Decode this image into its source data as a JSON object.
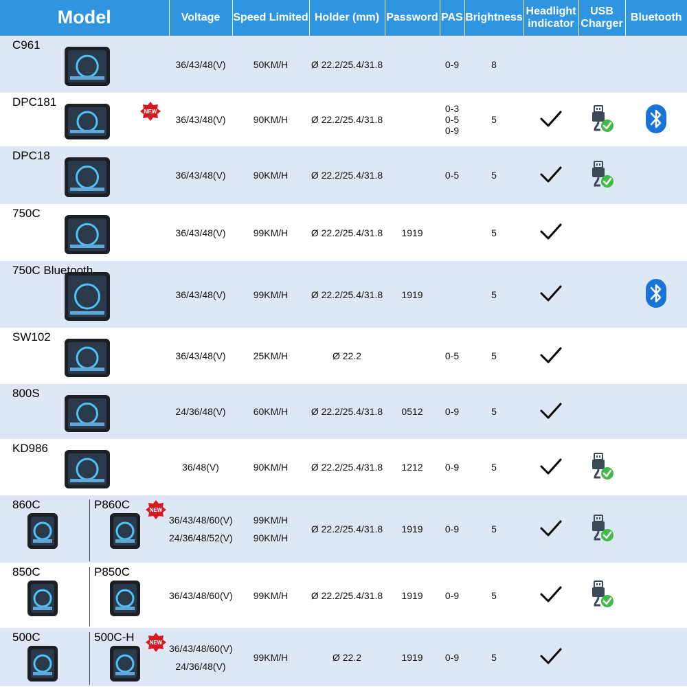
{
  "headers": {
    "model": "Model",
    "voltage": "Voltage",
    "speed": "Speed Limited",
    "holder": "Holder (mm)",
    "password": "Password",
    "pas": "PAS",
    "brightness": "Brightness",
    "headlight_1": "Headlight",
    "headlight_2": "indicator",
    "usb_1": "USB",
    "usb_2": "Charger",
    "bluetooth": "Bluetooth"
  },
  "badges": {
    "new": "NEW"
  },
  "rows": [
    {
      "model": "C961",
      "voltage": "36/43/48(V)",
      "speed": "50KM/H",
      "holder": "Ø 22.2/25.4/31.8",
      "password": "",
      "pas": "0-9",
      "brightness": "8",
      "headlight": false,
      "usb": false,
      "bluetooth": false
    },
    {
      "model": "DPC181",
      "new_badge": true,
      "voltage": "36/43/48(V)",
      "speed": "90KM/H",
      "holder": "Ø 22.2/25.4/31.8",
      "password": "",
      "pas": [
        "0-3",
        "0-5",
        "0-9"
      ],
      "brightness": "5",
      "headlight": true,
      "usb": true,
      "bluetooth": true
    },
    {
      "model": "DPC18",
      "voltage": "36/43/48(V)",
      "speed": "90KM/H",
      "holder": "Ø 22.2/25.4/31.8",
      "password": "",
      "pas": "0-5",
      "brightness": "5",
      "headlight": true,
      "usb": true,
      "bluetooth": false
    },
    {
      "model": "750C",
      "voltage": "36/43/48(V)",
      "speed": "99KM/H",
      "holder": "Ø 22.2/25.4/31.8",
      "password": "1919",
      "pas": "",
      "brightness": "5",
      "headlight": true,
      "usb": false,
      "bluetooth": false
    },
    {
      "model": "750C Bluetooth",
      "voltage": "36/43/48(V)",
      "speed": "99KM/H",
      "holder": "Ø 22.2/25.4/31.8",
      "password": "1919",
      "pas": "",
      "brightness": "5",
      "headlight": true,
      "usb": false,
      "bluetooth": true
    },
    {
      "model": "SW102",
      "voltage": "36/43/48(V)",
      "speed": "25KM/H",
      "holder": "Ø 22.2",
      "password": "",
      "pas": "0-5",
      "brightness": "5",
      "headlight": true,
      "usb": false,
      "bluetooth": false
    },
    {
      "model": "800S",
      "voltage": "24/36/48(V)",
      "speed": "60KM/H",
      "holder": "Ø 22.2/25.4/31.8",
      "password": "0512",
      "pas": "0-9",
      "brightness": "5",
      "headlight": true,
      "usb": false,
      "bluetooth": false
    },
    {
      "model": "KD986",
      "voltage": "36/48(V)",
      "speed": "90KM/H",
      "holder": "Ø 22.2/25.4/31.8",
      "password": "1212",
      "pas": "0-9",
      "brightness": "5",
      "headlight": true,
      "usb": true,
      "bluetooth": false
    },
    {
      "model": "860C",
      "model_b": "P860C",
      "new_badge": true,
      "voltage": [
        "36/43/48/60(V)",
        "24/36/48/52(V)"
      ],
      "speed": [
        "99KM/H",
        "90KM/H"
      ],
      "holder": "Ø 22.2/25.4/31.8",
      "password": "1919",
      "pas": "0-9",
      "brightness": "5",
      "headlight": true,
      "usb": true,
      "bluetooth": false
    },
    {
      "model": "850C",
      "model_b": "P850C",
      "voltage": "36/43/48/60(V)",
      "speed": "99KM/H",
      "holder": "Ø 22.2/25.4/31.8",
      "password": "1919",
      "pas": "0-9",
      "brightness": "5",
      "headlight": true,
      "usb": true,
      "bluetooth": false
    },
    {
      "model": "500C",
      "model_b": "500C-H",
      "new_badge": true,
      "voltage": [
        "36/43/48/60(V)",
        "24/36/48(V)"
      ],
      "speed": "99KM/H",
      "holder": "Ø 22.2",
      "password": "1919",
      "pas": "0-9",
      "brightness": "5",
      "headlight": true,
      "usb": false,
      "bluetooth": false
    }
  ],
  "colors": {
    "header_bg": "#2f95e0",
    "row_shade": "#dde7f6",
    "check": "#000000",
    "usb_icon": "#3a4a55",
    "usb_check": "#43b94a",
    "bluetooth": "#1a73d6",
    "new_badge": "#d71920"
  },
  "icons": {
    "headlight": "checkmark-icon",
    "usb": "usb-charger-icon",
    "bluetooth": "bluetooth-icon",
    "new": "new-badge-icon"
  }
}
